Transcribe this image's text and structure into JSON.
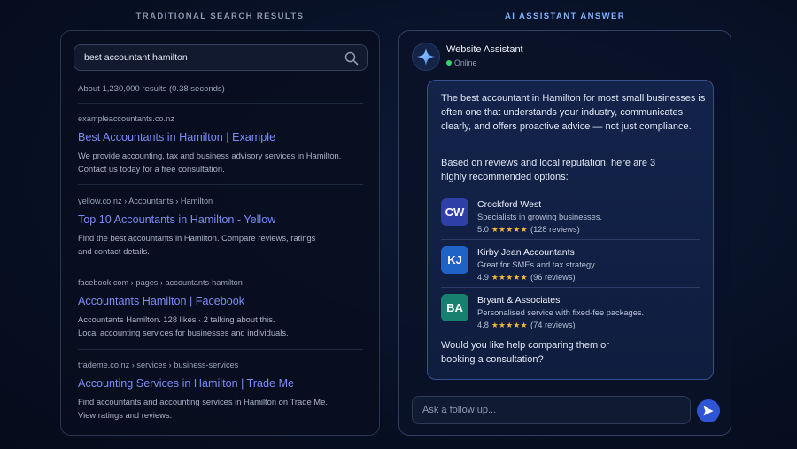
{
  "headings": {
    "traditional": "TRADITIONAL SEARCH RESULTS",
    "assistant": "AI ASSISTANT ANSWER"
  },
  "search": {
    "query": "best accountant hamilton",
    "icon": "search-icon",
    "result_count": "About 1,230,000 results (0.38 seconds)",
    "results": [
      {
        "url": "exampleaccountants.co.nz",
        "title": "Best Accountants in Hamilton | Example",
        "desc1": "We provide accounting, tax and business advisory services in Hamilton.",
        "desc2": "Contact us today for a free consultation."
      },
      {
        "url": "yellow.co.nz › Accountants › Hamilton",
        "title": "Top 10 Accountants in Hamilton - Yellow",
        "desc1": "Find the best accountants in Hamilton. Compare reviews, ratings",
        "desc2": "and contact details."
      },
      {
        "url": "facebook.com › pages › accountants-hamilton",
        "title": "Accountants Hamilton | Facebook",
        "desc1": "Accountants Hamilton. 128 likes · 2 talking about this.",
        "desc2": "Local accounting services for businesses and individuals."
      },
      {
        "url": "trademe.co.nz › services › business-services",
        "title": "Accounting Services in Hamilton | Trade Me",
        "desc1": "Find accountants and accounting services in Hamilton on Trade Me.",
        "desc2": "View ratings and reviews."
      }
    ]
  },
  "assistant": {
    "name": "Website Assistant",
    "status": "Online",
    "icon": "sparkle-icon",
    "intro": "The best accountant in Hamilton for most small businesses is often one that understands your industry, communicates clearly, and offers proactive advice — not just compliance.",
    "lead": "Based on reviews and local reputation, here are 3 highly recommended options:",
    "options": [
      {
        "initials": "CW",
        "name": "Crockford West",
        "desc": "Specialists in growing businesses.",
        "rating": "5.0",
        "stars": "★★★★★",
        "reviews": "(128 reviews)",
        "color": "#2f3fa8"
      },
      {
        "initials": "KJ",
        "name": "Kirby Jean Accountants",
        "desc": "Great for SMEs and tax strategy.",
        "rating": "4.9",
        "stars": "★★★★★",
        "reviews": "(96 reviews)",
        "color": "#1f63c7"
      },
      {
        "initials": "BA",
        "name": "Bryant & Associates",
        "desc": "Personalised service with fixed-fee packages.",
        "rating": "4.8",
        "stars": "★★★★★",
        "reviews": "(74 reviews)",
        "color": "#17806f"
      }
    ],
    "closing": "Would you like help comparing them or booking a consultation?",
    "followup_placeholder": "Ask a follow up...",
    "send_icon": "send-icon"
  }
}
